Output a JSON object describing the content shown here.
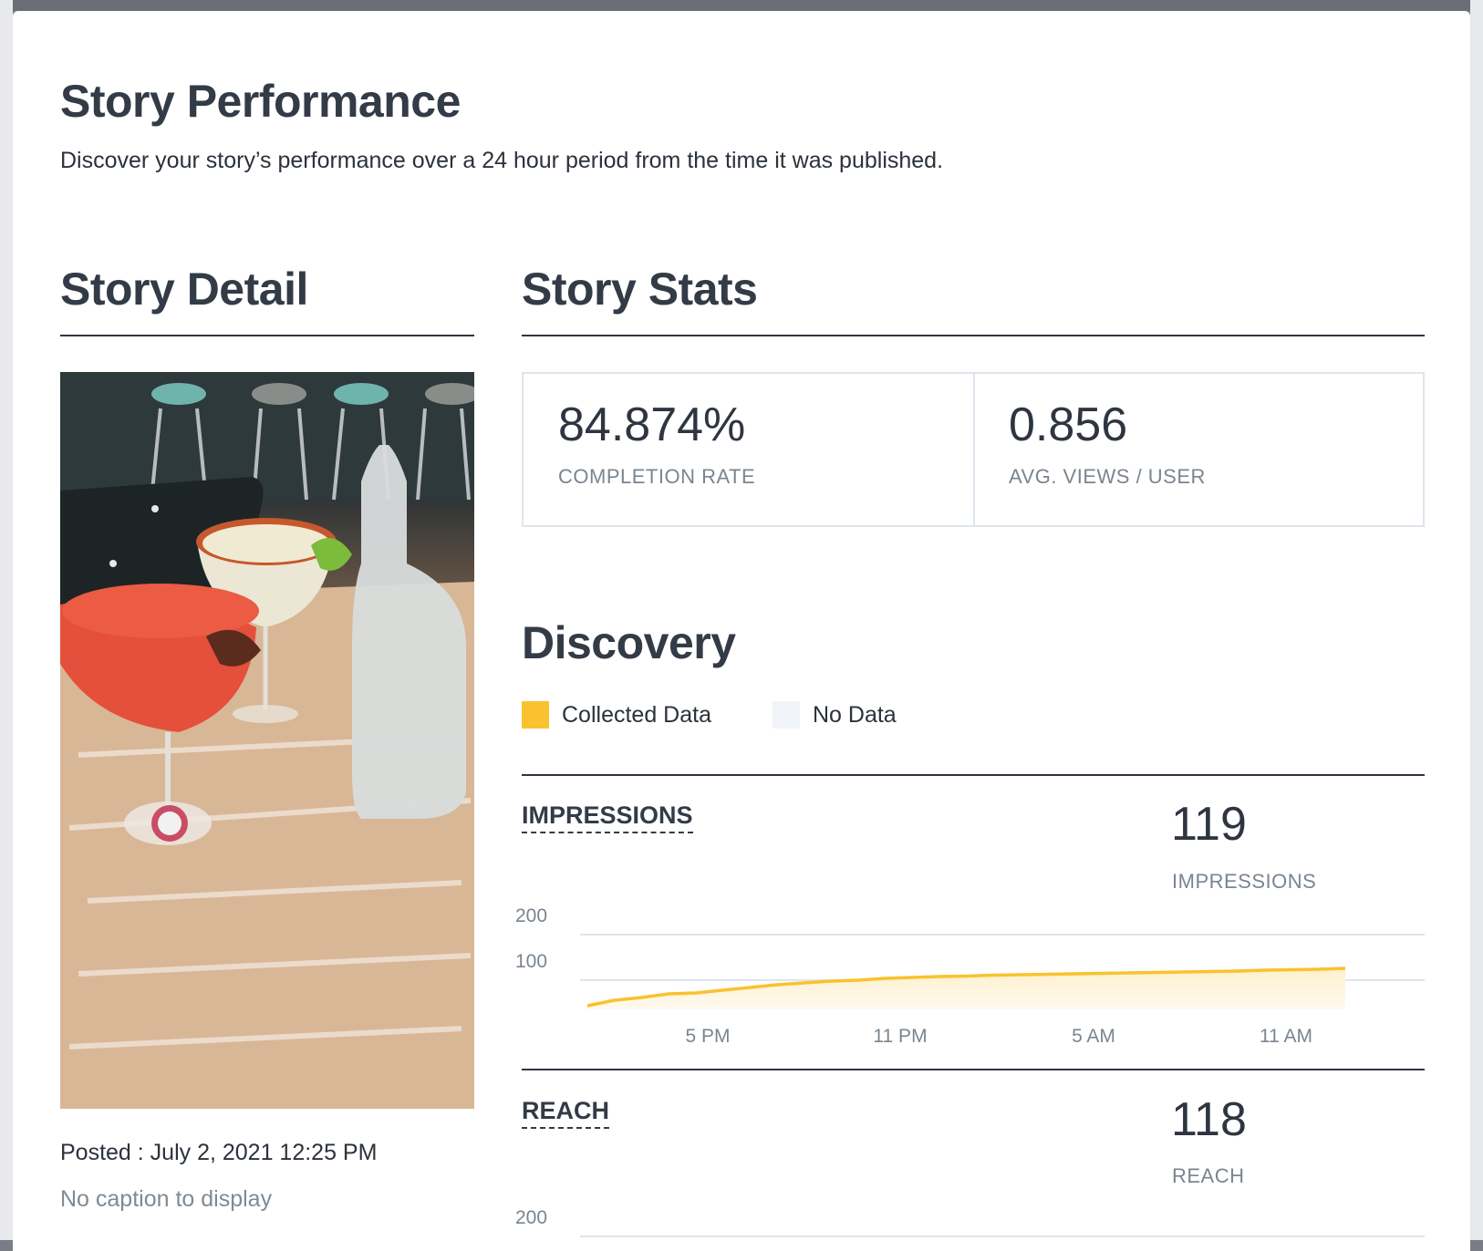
{
  "header": {
    "title": "Story Performance",
    "subtitle": "Discover your story’s performance over a 24 hour period from the time it was published."
  },
  "story_detail": {
    "heading": "Story Detail",
    "posted": "Posted : July 2, 2021 12:25 PM",
    "caption": "No caption to display"
  },
  "story_stats": {
    "heading": "Story Stats",
    "completion_rate": {
      "value": "84.874%",
      "label": "COMPLETION RATE"
    },
    "avg_views": {
      "value": "0.856",
      "label": "AVG. VIEWS / USER"
    }
  },
  "discovery": {
    "heading": "Discovery",
    "legend": [
      {
        "label": "Collected Data",
        "color": "#f9c22e"
      },
      {
        "label": "No Data",
        "color": "#f0f3f7"
      }
    ]
  },
  "colors": {
    "line": "#f9c22e",
    "fill": "#fdf0cc",
    "grid": "#dfe5ec",
    "text": "#333b47",
    "muted": "#7a8590"
  },
  "metrics": {
    "impressions": {
      "name": "IMPRESSIONS",
      "value": "119",
      "label": "IMPRESSIONS"
    },
    "reach": {
      "name": "REACH",
      "value": "118",
      "label": "REACH"
    }
  },
  "chart_data": [
    {
      "type": "area",
      "ylabel": "",
      "yticks": [
        "200",
        "100"
      ],
      "ylim": [
        0,
        200
      ],
      "xticks": [
        "5 PM",
        "11 PM",
        "5 AM",
        "11 AM"
      ],
      "series": [
        {
          "values": [
            8,
            20,
            26,
            34,
            36,
            42,
            48,
            54,
            58,
            62,
            64,
            68,
            70,
            72,
            73,
            75,
            76,
            77,
            78,
            79,
            80,
            81,
            82,
            83,
            84,
            86,
            87,
            88,
            90
          ]
        }
      ]
    },
    {
      "type": "area",
      "ylabel": "",
      "yticks": [
        "200"
      ],
      "ylim": [
        0,
        200
      ],
      "series": []
    }
  ]
}
